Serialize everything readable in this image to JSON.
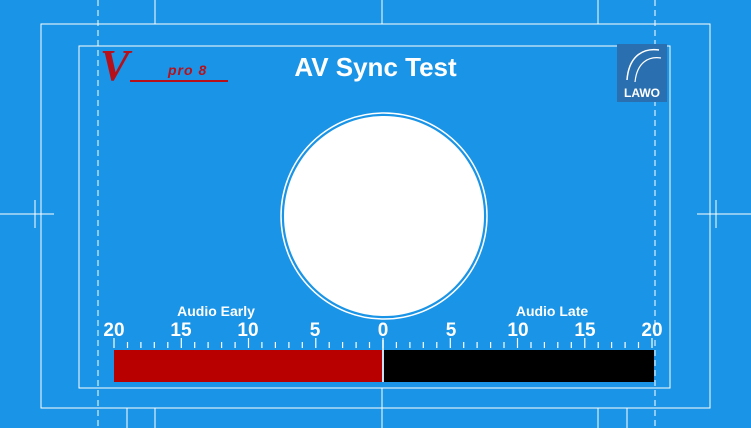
{
  "title": "AV Sync Test",
  "logos": {
    "left_brand_mark": "V",
    "left_brand_text": "pro 8",
    "right_brand_text": "LAWO"
  },
  "labels": {
    "audio_early": "Audio Early",
    "audio_late": "Audio Late"
  },
  "scale": {
    "left": [
      "20",
      "15",
      "10",
      "5"
    ],
    "center": "0",
    "right": [
      "5",
      "10",
      "15",
      "20"
    ]
  },
  "bars": {
    "early_color": "#b80000",
    "late_color": "#000000"
  },
  "colors": {
    "background": "#1a94e6",
    "lines": "#ffffff"
  }
}
